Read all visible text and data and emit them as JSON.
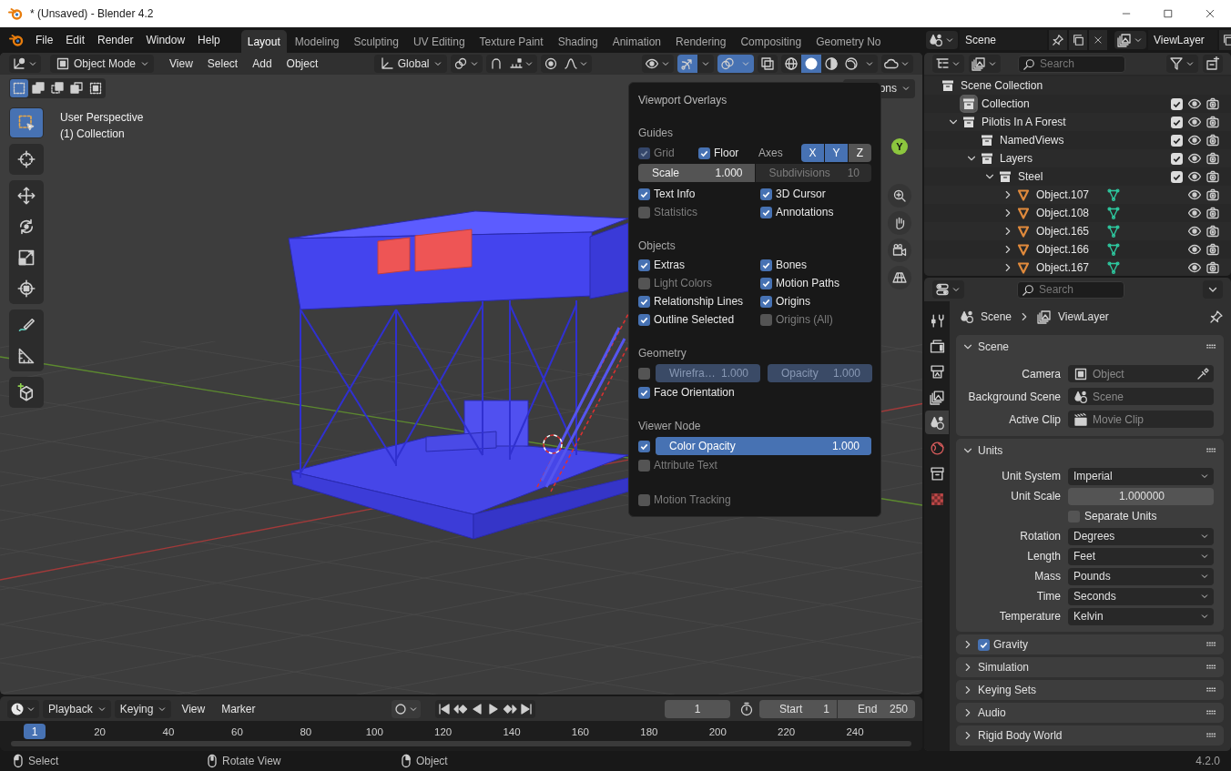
{
  "window": {
    "title": "* (Unsaved) - Blender 4.2"
  },
  "menus": [
    "File",
    "Edit",
    "Render",
    "Window",
    "Help"
  ],
  "workspaces": [
    {
      "label": "Layout",
      "selected": true
    },
    {
      "label": "Modeling",
      "selected": false
    },
    {
      "label": "Sculpting",
      "selected": false
    },
    {
      "label": "UV Editing",
      "selected": false
    },
    {
      "label": "Texture Paint",
      "selected": false
    },
    {
      "label": "Shading",
      "selected": false
    },
    {
      "label": "Animation",
      "selected": false
    },
    {
      "label": "Rendering",
      "selected": false
    },
    {
      "label": "Compositing",
      "selected": false
    },
    {
      "label": "Geometry No",
      "selected": false
    }
  ],
  "scene": {
    "name": "Scene"
  },
  "view_layer": {
    "name": "ViewLayer"
  },
  "viewport": {
    "mode": "Object Mode",
    "menus": [
      "View",
      "Select",
      "Add",
      "Object"
    ],
    "orientation": "Global",
    "gizmos": {
      "on": true
    },
    "overlays_toggle": {
      "on": true
    },
    "shading": [
      {
        "kind": "wireframe",
        "selected": false
      },
      {
        "kind": "solid",
        "selected": true
      },
      {
        "kind": "material",
        "selected": false
      },
      {
        "kind": "rendered",
        "selected": false
      }
    ],
    "select_modes": [
      {
        "kind": "set",
        "selected": true
      },
      {
        "kind": "extend",
        "selected": false
      },
      {
        "kind": "subtract",
        "selected": false
      },
      {
        "kind": "invert",
        "selected": false
      },
      {
        "kind": "intersect",
        "selected": false
      }
    ],
    "options_button": "ons",
    "info": [
      "User Perspective",
      "(1) Collection"
    ],
    "axis_label": "Y",
    "tool_groups": [
      [
        {
          "kind": "select-box",
          "selected": true
        }
      ],
      [
        {
          "kind": "cursor",
          "selected": false
        }
      ],
      [
        {
          "kind": "move",
          "selected": false
        },
        {
          "kind": "rotate",
          "selected": false
        },
        {
          "kind": "scale",
          "selected": false
        },
        {
          "kind": "transform",
          "selected": false
        }
      ],
      [
        {
          "kind": "annotate",
          "selected": false
        },
        {
          "kind": "measure",
          "selected": false
        }
      ],
      [
        {
          "kind": "add-cube",
          "selected": false
        }
      ]
    ],
    "overlays": {
      "title": "Viewport Overlays",
      "guides": {
        "heading": "Guides",
        "grid": {
          "label": "Grid",
          "checked": true,
          "disabled": true
        },
        "floor": {
          "label": "Floor",
          "checked": true,
          "disabled": false
        },
        "axes_label": "Axes",
        "axes": [
          {
            "label": "X",
            "selected": true
          },
          {
            "label": "Y",
            "selected": true
          },
          {
            "label": "Z",
            "selected": false
          }
        ],
        "scale": {
          "label": "Scale",
          "value": "1.000"
        },
        "subdivisions": {
          "label": "Subdivisions",
          "value": "10",
          "disabled": true
        },
        "options": [
          {
            "label": "Text Info",
            "checked": true
          },
          {
            "label": "3D Cursor",
            "checked": true
          },
          {
            "label": "Statistics",
            "checked": false
          },
          {
            "label": "Annotations",
            "checked": true
          }
        ]
      },
      "objects": {
        "heading": "Objects",
        "options": [
          {
            "label": "Extras",
            "checked": true
          },
          {
            "label": "Bones",
            "checked": true
          },
          {
            "label": "Light Colors",
            "checked": false
          },
          {
            "label": "Motion Paths",
            "checked": true
          },
          {
            "label": "Relationship Lines",
            "checked": true
          },
          {
            "label": "Origins",
            "checked": true
          },
          {
            "label": "Outline Selected",
            "checked": true
          },
          {
            "label": "Origins (All)",
            "checked": false
          }
        ]
      },
      "geometry": {
        "heading": "Geometry",
        "wireframe": {
          "checked": false,
          "label": "Wirefra…",
          "value": "1.000"
        },
        "opacity": {
          "label": "Opacity",
          "value": "1.000"
        },
        "options": [
          {
            "label": "Face Orientation",
            "checked": true
          }
        ]
      },
      "viewer_node": {
        "heading": "Viewer Node",
        "color_opacity": {
          "checked": true,
          "label": "Color Opacity",
          "value": "1.000",
          "level": 1
        },
        "options": [
          {
            "label": "Attribute Text",
            "checked": false
          }
        ]
      },
      "motion_tracking": {
        "label": "Motion Tracking",
        "checked": false
      }
    }
  },
  "outliner": {
    "search": {
      "placeholder": "Search"
    },
    "root": "Scene Collection",
    "items": [
      {
        "kind": "collection",
        "name": "Collection",
        "selected": true,
        "checked": true
      },
      {
        "kind": "collection",
        "name": "Pilotis In A Forest",
        "selected": false,
        "checked": true,
        "expanded": true,
        "children": [
          {
            "kind": "collection",
            "name": "NamedViews",
            "selected": false,
            "checked": true
          },
          {
            "kind": "collection",
            "name": "Layers",
            "selected": false,
            "checked": true,
            "expanded": true,
            "children": [
              {
                "kind": "collection",
                "name": "Steel",
                "selected": false,
                "checked": true,
                "expanded": true,
                "children": [
                  {
                    "kind": "object",
                    "name": "Object.107",
                    "selected": false,
                    "expanded": false
                  },
                  {
                    "kind": "object",
                    "name": "Object.108",
                    "selected": false,
                    "expanded": false
                  },
                  {
                    "kind": "object",
                    "name": "Object.165",
                    "selected": false,
                    "expanded": false
                  },
                  {
                    "kind": "object",
                    "name": "Object.166",
                    "selected": false,
                    "expanded": false
                  },
                  {
                    "kind": "object",
                    "name": "Object.167",
                    "selected": false,
                    "expanded": false
                  }
                ]
              }
            ]
          }
        ]
      }
    ]
  },
  "properties": {
    "search": {
      "placeholder": "Search"
    },
    "tabs": [
      {
        "kind": "tool",
        "selected": false
      },
      {
        "kind": "render",
        "selected": false
      },
      {
        "kind": "output",
        "selected": false
      },
      {
        "kind": "view-layer",
        "selected": false
      },
      {
        "kind": "scene",
        "selected": true
      },
      {
        "kind": "world",
        "selected": false
      },
      {
        "kind": "collection",
        "selected": false
      },
      {
        "kind": "texture",
        "selected": false
      }
    ],
    "breadcrumb": [
      "Scene",
      "ViewLayer"
    ],
    "panels": [
      {
        "title": "Scene",
        "expanded": true,
        "fields": [
          {
            "kind": "object",
            "label": "Camera",
            "placeholder": "Object"
          },
          {
            "kind": "scene",
            "label": "Background Scene",
            "placeholder": "Scene"
          },
          {
            "kind": "clip",
            "label": "Active Clip",
            "placeholder": "Movie Clip"
          }
        ]
      },
      {
        "title": "Units",
        "expanded": true,
        "fields": [
          {
            "kind": "dropdown",
            "label": "Unit System",
            "value": "Imperial"
          },
          {
            "kind": "number",
            "label": "Unit Scale",
            "value": "1.000000"
          },
          {
            "kind": "checkbox",
            "label": "Separate Units",
            "checked": false
          },
          {
            "kind": "dropdown",
            "label": "Rotation",
            "value": "Degrees"
          },
          {
            "kind": "dropdown",
            "label": "Length",
            "value": "Feet"
          },
          {
            "kind": "dropdown",
            "label": "Mass",
            "value": "Pounds"
          },
          {
            "kind": "dropdown",
            "label": "Time",
            "value": "Seconds"
          },
          {
            "kind": "dropdown",
            "label": "Temperature",
            "value": "Kelvin"
          }
        ]
      },
      {
        "title": "Gravity",
        "expanded": false,
        "checked": true
      },
      {
        "title": "Simulation",
        "expanded": false
      },
      {
        "title": "Keying Sets",
        "expanded": false
      },
      {
        "title": "Audio",
        "expanded": false
      },
      {
        "title": "Rigid Body World",
        "expanded": false
      }
    ]
  },
  "timeline": {
    "menus": [
      "Playback",
      "Keying",
      "View",
      "Marker"
    ],
    "auto_keying": {
      "on": false
    },
    "current_frame": "1",
    "start": {
      "label": "Start",
      "value": "1"
    },
    "end": {
      "label": "End",
      "value": "250"
    },
    "ruler": {
      "current": "1",
      "ticks": [
        "20",
        "40",
        "60",
        "80",
        "100",
        "120",
        "140",
        "160",
        "180",
        "200",
        "220",
        "240"
      ]
    }
  },
  "status_bar": {
    "hints": [
      {
        "kind": "left-click",
        "label": "Select"
      },
      {
        "kind": "middle-click",
        "label": "Rotate View"
      },
      {
        "kind": "right-click",
        "label": "Object"
      }
    ],
    "version": "4.2.0"
  }
}
